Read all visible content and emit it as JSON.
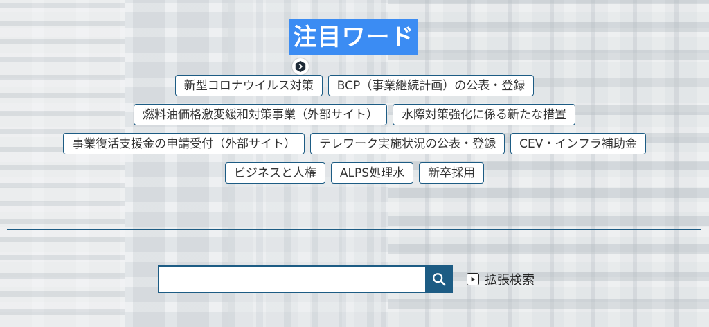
{
  "header": {
    "title": "注目ワード"
  },
  "tags": [
    [
      "新型コロナウイルス対策",
      "BCP（事業継続計画）の公表・登録"
    ],
    [
      "燃料油価格激変緩和対策事業（外部サイト）",
      "水際対策強化に係る新たな措置"
    ],
    [
      "事業復活支援金の申請受付（外部サイト）",
      "テレワーク実施状況の公表・登録",
      "CEV・インフラ補助金"
    ],
    [
      "ビジネスと人権",
      "ALPS処理水",
      "新卒採用"
    ]
  ],
  "search": {
    "value": "",
    "placeholder": "",
    "button_icon": "search-icon"
  },
  "advanced_search": {
    "label": "拡張検索",
    "icon": "play-box-icon"
  },
  "colors": {
    "accent": "#1d5c84",
    "highlight": "#3b8cf3"
  }
}
